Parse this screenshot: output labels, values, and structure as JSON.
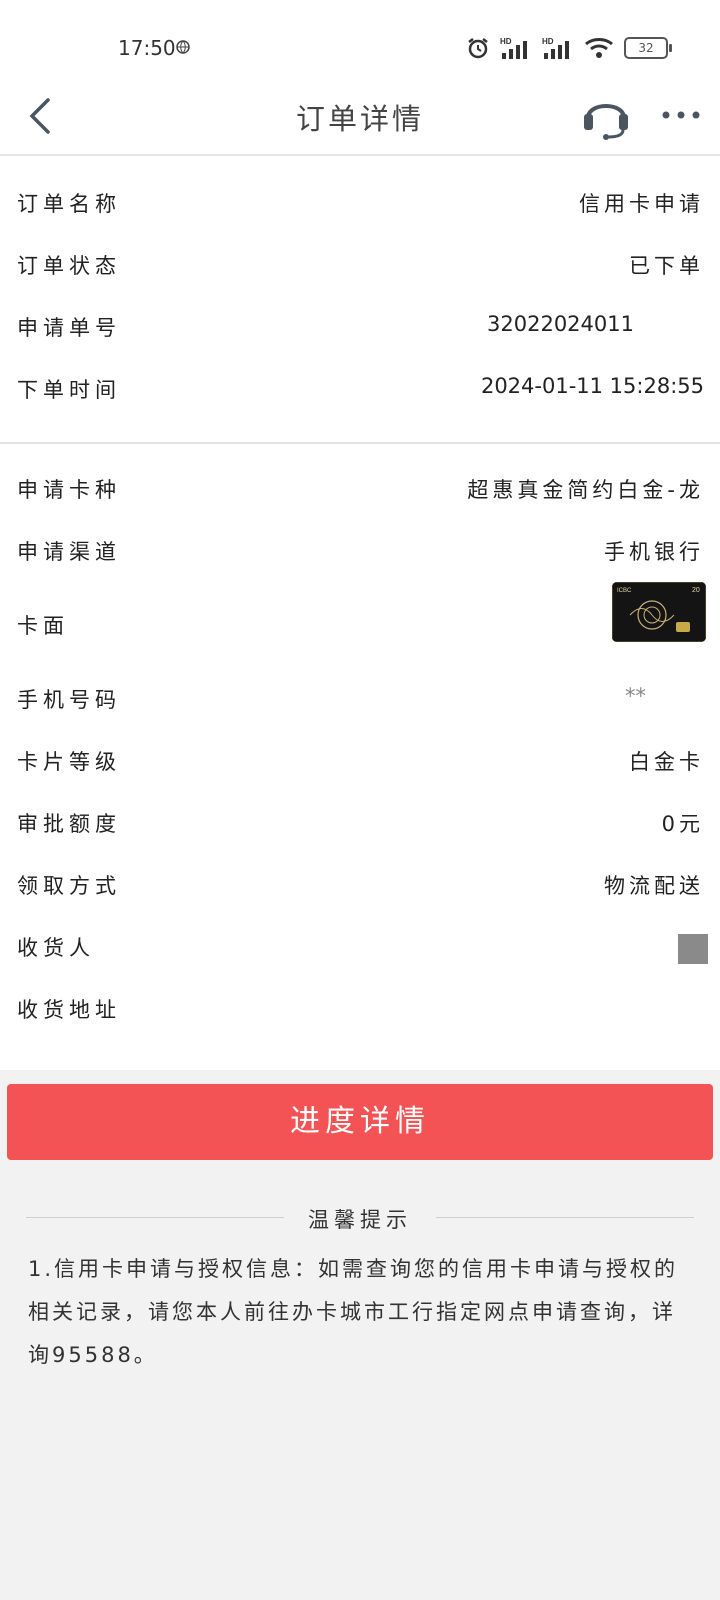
{
  "status_bar": {
    "time": "17:50",
    "battery": "32",
    "icons": [
      "globe-icon",
      "alarm-icon",
      "hd-signal-icon",
      "hd-signal-icon",
      "wifi-icon",
      "battery-icon"
    ]
  },
  "header": {
    "title": "订单详情",
    "back_icon": "back-arrow-icon",
    "service_icon": "headset-icon",
    "more_icon": "more-dots-icon"
  },
  "order_info": [
    {
      "label": "订单名称",
      "value": "信用卡申请"
    },
    {
      "label": "订单状态",
      "value": "已下单"
    },
    {
      "label": "申请单号",
      "value": "32022024011"
    },
    {
      "label": "下单时间",
      "value": "2024-01-11 15:28:55"
    }
  ],
  "card_info": [
    {
      "label": "申请卡种",
      "value": "超惠真金简约白金-龙"
    },
    {
      "label": "申请渠道",
      "value": "手机银行"
    },
    {
      "label": "卡面",
      "value": ""
    },
    {
      "label": "手机号码",
      "value": "**"
    },
    {
      "label": "卡片等级",
      "value": "白金卡"
    },
    {
      "label": "审批额度",
      "value": "0元"
    },
    {
      "label": "领取方式",
      "value": "物流配送"
    },
    {
      "label": "收货人",
      "value": ""
    },
    {
      "label": "收货地址",
      "value": ""
    }
  ],
  "card_face": {
    "brand_text": "ICBC"
  },
  "progress_button": "进度详情",
  "tips": {
    "title": "温馨提示",
    "text": "1.信用卡申请与授权信息：如需查询您的信用卡申请与授权的相关记录，请您本人前往办卡城市工行指定网点申请查询，详询95588。"
  },
  "colors": {
    "accent": "#f35354",
    "background": "#f2f2f2"
  }
}
